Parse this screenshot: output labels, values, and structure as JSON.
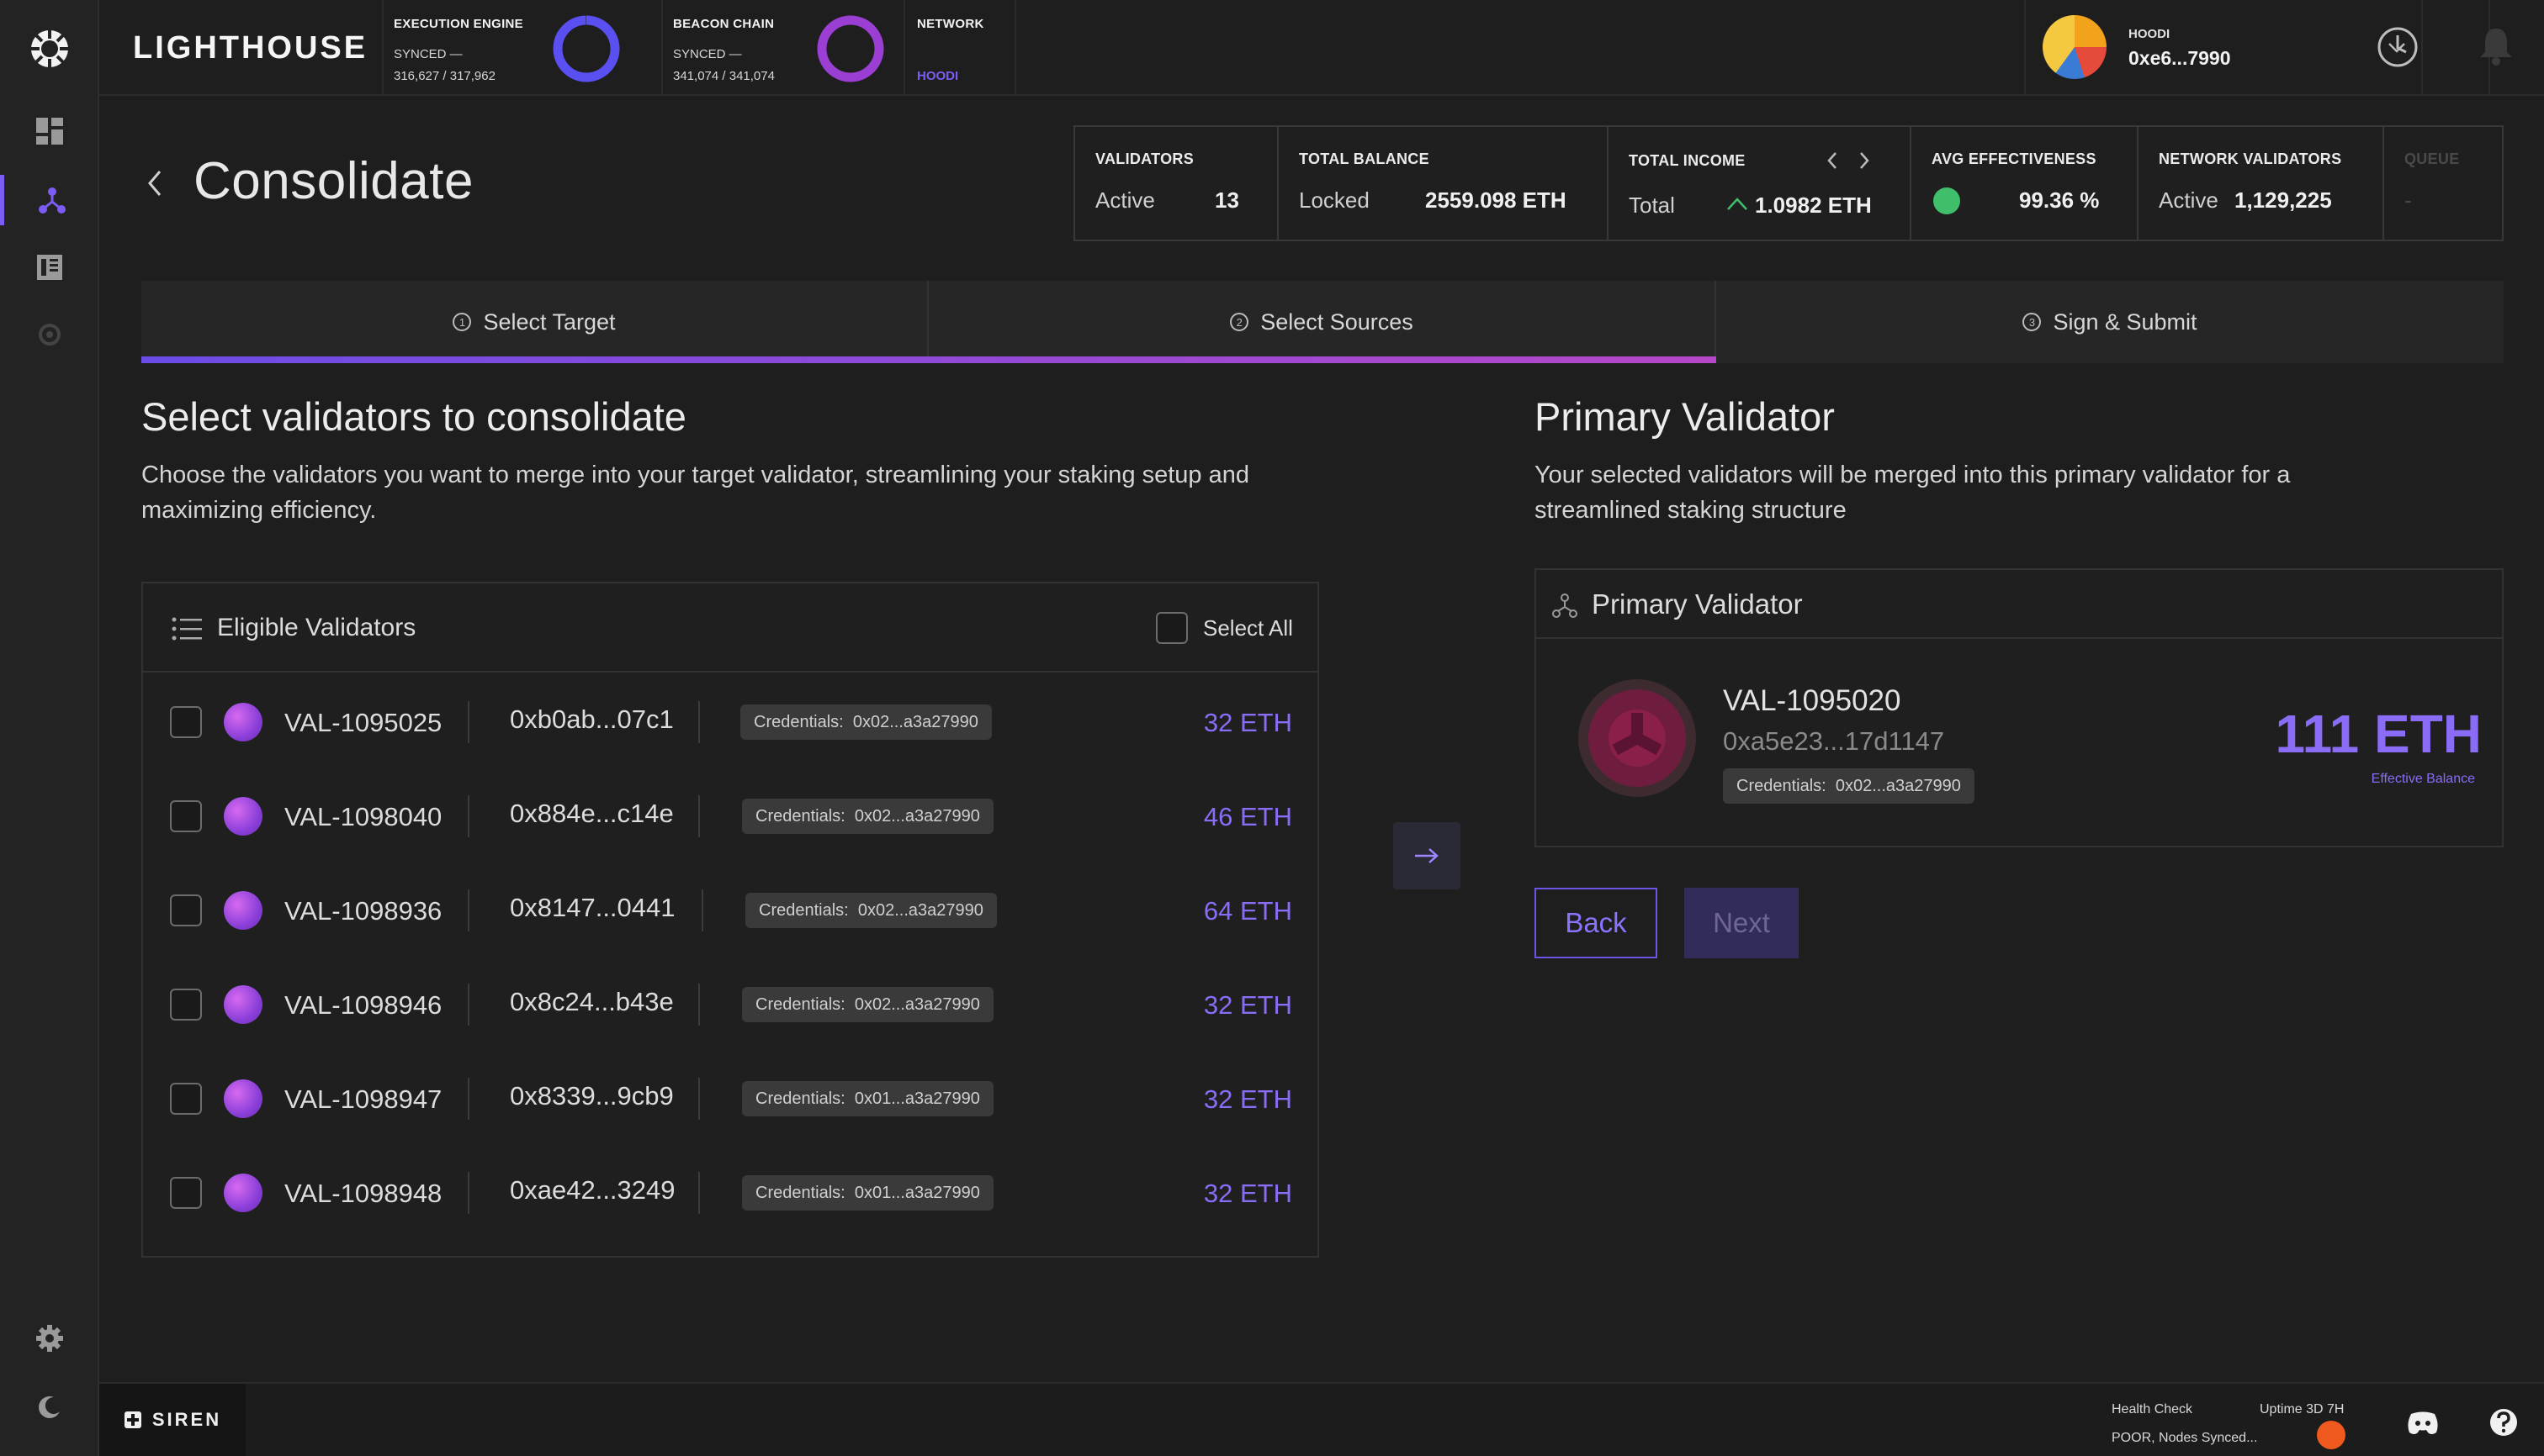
{
  "app": {
    "logo_text": "LIGHTHOUSE"
  },
  "topbar": {
    "execution": {
      "label": "EXECUTION ENGINE",
      "status": "SYNCED —",
      "progress": "316,627 / 317,962",
      "ring_color": "#5a4ff0",
      "sync_fraction": 0.996
    },
    "beacon": {
      "label": "BEACON CHAIN",
      "status": "SYNCED —",
      "progress": "341,074 / 341,074",
      "ring_color": "#9b3fd4",
      "sync_fraction": 1.0
    },
    "network": {
      "label": "NETWORK",
      "value": "HOODI"
    },
    "account": {
      "network": "HOODI",
      "address": "0xe6...7990"
    }
  },
  "sidebar": {
    "items": [
      "dashboard",
      "validator-management",
      "logs",
      "sync"
    ],
    "active": "validator-management"
  },
  "header": {
    "title": "Consolidate"
  },
  "stats": {
    "validators": {
      "label": "VALIDATORS",
      "sub": "Active",
      "value": "13"
    },
    "balance": {
      "label": "TOTAL BALANCE",
      "sub": "Locked",
      "value": "2559.098 ETH"
    },
    "income": {
      "label": "TOTAL INCOME",
      "sub": "Total",
      "value": "1.0982 ETH"
    },
    "effectiveness": {
      "label": "AVG EFFECTIVENESS",
      "value": "99.36 %",
      "status_color": "#3fbf6a"
    },
    "network_validators": {
      "label": "NETWORK VALIDATORS",
      "sub": "Active",
      "value": "1,129,225"
    },
    "queue": {
      "label": "QUEUE",
      "value": "-"
    }
  },
  "steps": [
    {
      "num": "1",
      "label": "Select Target"
    },
    {
      "num": "2",
      "label": "Select Sources"
    },
    {
      "num": "3",
      "label": "Sign & Submit"
    }
  ],
  "left": {
    "title": "Select validators to consolidate",
    "desc1": "Choose the validators you want to merge into your target validator, streamlining your staking setup and",
    "desc2": "maximizing efficiency.",
    "list_title": "Eligible Validators",
    "select_all": "Select All"
  },
  "validators": [
    {
      "name": "VAL-1095025",
      "addr": "0xb0ab...07c1",
      "cred_label": "Credentials:",
      "cred": "0x02...a3a27990",
      "eth": "32 ETH"
    },
    {
      "name": "VAL-1098040",
      "addr": "0x884e...c14e",
      "cred_label": "Credentials:",
      "cred": "0x02...a3a27990",
      "eth": "46 ETH"
    },
    {
      "name": "VAL-1098936",
      "addr": "0x8147...0441",
      "cred_label": "Credentials:",
      "cred": "0x02...a3a27990",
      "eth": "64 ETH"
    },
    {
      "name": "VAL-1098946",
      "addr": "0x8c24...b43e",
      "cred_label": "Credentials:",
      "cred": "0x02...a3a27990",
      "eth": "32 ETH"
    },
    {
      "name": "VAL-1098947",
      "addr": "0x8339...9cb9",
      "cred_label": "Credentials:",
      "cred": "0x01...a3a27990",
      "eth": "32 ETH"
    },
    {
      "name": "VAL-1098948",
      "addr": "0xae42...3249",
      "cred_label": "Credentials:",
      "cred": "0x01...a3a27990",
      "eth": "32 ETH"
    }
  ],
  "right": {
    "title": "Primary Validator",
    "desc1": "Your selected validators will be merged into this primary validator for a",
    "desc2": "streamlined staking structure",
    "card_title": "Primary Validator",
    "primary": {
      "name": "VAL-1095020",
      "addr": "0xa5e23...17d1147",
      "cred_label": "Credentials:",
      "cred": "0x02...a3a27990",
      "balance": "111 ETH",
      "balance_label": "Effective Balance"
    }
  },
  "buttons": {
    "back": "Back",
    "next": "Next"
  },
  "footer": {
    "brand": "SIREN",
    "health_label": "Health Check",
    "health_value": "POOR, Nodes Synced...",
    "uptime": "Uptime 3D 7H",
    "health_color": "#f05a1e"
  },
  "colors": {
    "accent": "#7c5cf5",
    "eth": "#8a6cf7"
  }
}
